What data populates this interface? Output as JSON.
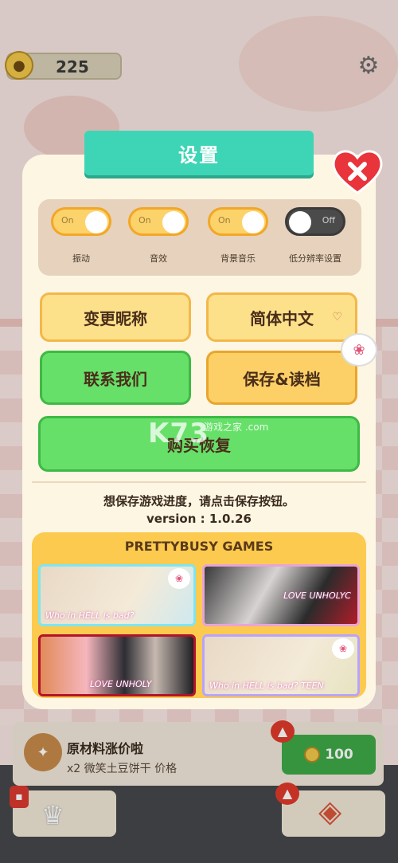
{
  "hud": {
    "coins": "225"
  },
  "settings": {
    "title": "设置",
    "toggles": [
      {
        "state": "On",
        "caption": "振动"
      },
      {
        "state": "On",
        "caption": "音效"
      },
      {
        "state": "On",
        "caption": "背景音乐"
      },
      {
        "state": "Off",
        "caption": "低分辨率设置"
      }
    ],
    "buttons": {
      "nickname": "变更昵称",
      "language": "简体中文",
      "contact": "联系我们",
      "save_load": "保存&读档",
      "restore": "购买恢复"
    },
    "hint": "想保存游戏进度，请点击保存按钮。",
    "version": "version : 1.0.26"
  },
  "games": {
    "title": "PRETTYBUSY GAMES",
    "cards": [
      {
        "caption": "Who in HELL is bad?"
      },
      {
        "caption": "LOVE UNHOLYC"
      },
      {
        "caption": "LOVE UNHOLY"
      },
      {
        "caption": "Who in HELL is bad? TEEN"
      }
    ]
  },
  "mission": {
    "title": "原材料涨价啦",
    "desc": "x2 微笑土豆饼干 价格",
    "price": "100"
  },
  "watermark": {
    "main": "K73",
    "sub": "游戏之家 .com"
  },
  "colors": {
    "accent": "#3dd5b5",
    "green": "#67e06a",
    "yellow": "#fde08a",
    "orange": "#fcd066"
  }
}
